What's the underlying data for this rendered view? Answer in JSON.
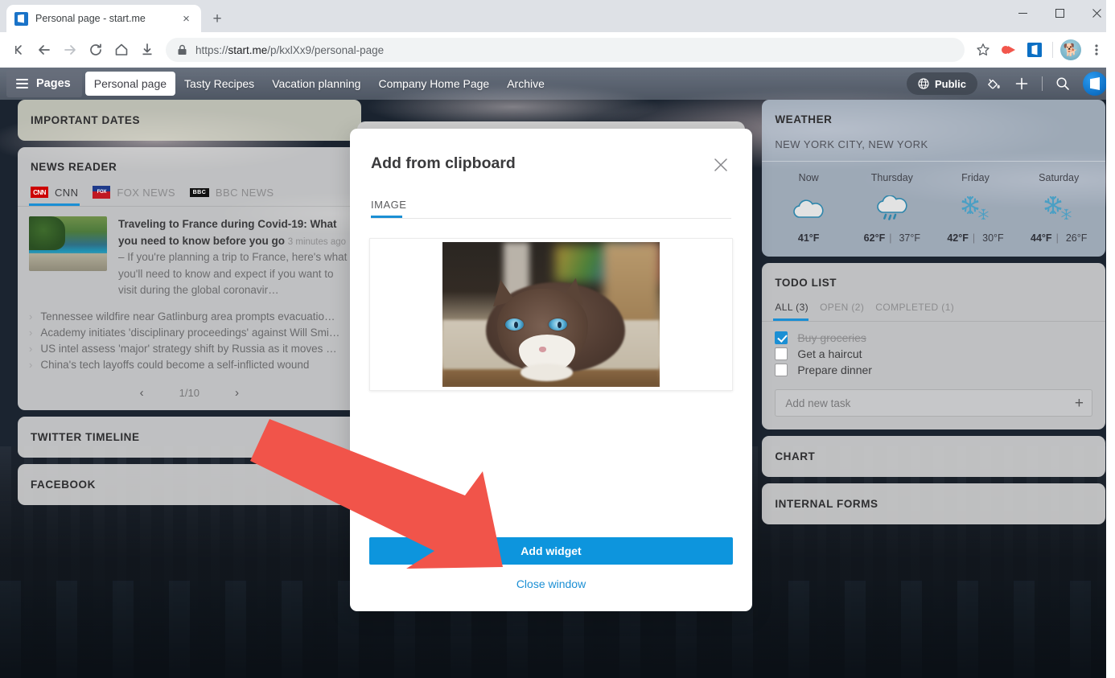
{
  "browser": {
    "tab": {
      "title": "Personal page - start.me",
      "favicon": "startme-logo-icon",
      "close": "×"
    },
    "new_tab_label": "+",
    "window_controls": {
      "minimize": "minimize-icon",
      "maximize": "maximize-icon",
      "close": "close-icon"
    },
    "toolbar": {
      "first_page": "⧏|",
      "back": "←",
      "forward": "→",
      "reload": "↻",
      "home": "⌂",
      "downloads": "download-icon",
      "lock": "lock-icon",
      "url_scheme": "https://",
      "url_host": "start.me",
      "url_path": "/p/kxlXx9/personal-page",
      "url_full": "https://start.me/p/kxlXx9/personal-page",
      "bookmark": "star-icon",
      "ext_pocket": "pocket-extension-icon",
      "ext_startme": "startme-extension-icon",
      "profile": "profile-avatar",
      "menu": "kebab-menu-icon"
    }
  },
  "topnav": {
    "pages_label": "Pages",
    "tabs": [
      {
        "label": "Personal page",
        "active": true
      },
      {
        "label": "Tasty Recipes",
        "active": false
      },
      {
        "label": "Vacation planning",
        "active": false
      },
      {
        "label": "Company Home Page",
        "active": false
      },
      {
        "label": "Archive",
        "active": false
      }
    ],
    "public_label": "Public",
    "public_icon": "globe-icon",
    "theme_icon": "paint-bucket-icon",
    "add_icon": "plus-icon",
    "search_icon": "search-icon",
    "app_logo": "startme-logo-icon"
  },
  "widgets": {
    "important_dates": {
      "title": "IMPORTANT DATES"
    },
    "news_reader": {
      "title": "NEWS READER",
      "sources": [
        {
          "label": "CNN",
          "logo": "cnn-logo",
          "active": true
        },
        {
          "label": "FOX NEWS",
          "logo": "fox-news-logo",
          "active": false
        },
        {
          "label": "BBC NEWS",
          "logo": "bbc-news-logo",
          "active": false
        }
      ],
      "featured": {
        "headline": "Traveling to France during Covid-19: What you need to know before you go",
        "time": "3 minutes ago",
        "dash": "–",
        "excerpt": "If you're planning a trip to France, here's what you'll need to know and expect if you want to visit during the global coronavir…"
      },
      "items": [
        "Tennessee wildfire near Gatlinburg area prompts evacuatio…",
        "Academy initiates 'disciplinary proceedings' against Will Smi…",
        "US intel assess 'major' strategy shift by Russia as it moves …",
        "China's tech layoffs could become a self-inflicted wound"
      ],
      "pager": {
        "prev": "‹",
        "page": "1/10",
        "next": "›"
      }
    },
    "twitter_timeline": {
      "title": "TWITTER TIMELINE"
    },
    "facebook": {
      "title": "FACEBOOK"
    },
    "weather": {
      "title": "WEATHER",
      "location": "NEW YORK CITY, NEW YORK",
      "days": [
        {
          "name": "Now",
          "icon": "cloud-icon",
          "high": "41°F",
          "low": ""
        },
        {
          "name": "Thursday",
          "icon": "rain-cloud-icon",
          "high": "62°F",
          "low": "37°F"
        },
        {
          "name": "Friday",
          "icon": "snow-icon",
          "high": "42°F",
          "low": "30°F"
        },
        {
          "name": "Saturday",
          "icon": "snow-icon",
          "high": "44°F",
          "low": "26°F"
        }
      ],
      "separator": "|"
    },
    "todo_list": {
      "title": "TODO LIST",
      "tabs": [
        {
          "label": "ALL (3)",
          "active": true
        },
        {
          "label": "OPEN (2)",
          "active": false
        },
        {
          "label": "COMPLETED (1)",
          "active": false
        }
      ],
      "items": [
        {
          "label": "Buy groceries",
          "done": true
        },
        {
          "label": "Get a haircut",
          "done": false
        },
        {
          "label": "Prepare dinner",
          "done": false
        }
      ],
      "add_placeholder": "Add new task",
      "add_value": "",
      "add_icon": "plus-icon"
    },
    "chart": {
      "title": "CHART"
    },
    "internal_forms": {
      "title": "INTERNAL FORMS"
    }
  },
  "modal": {
    "title": "Add from clipboard",
    "close_icon": "close-icon",
    "tabs": [
      {
        "label": "IMAGE",
        "active": true
      }
    ],
    "preview_image": "cat-photo",
    "primary_button": "Add widget",
    "secondary_link": "Close window"
  },
  "annotation": {
    "arrow_color": "#f1544a",
    "points_to": "Add widget"
  },
  "colors": {
    "accent": "#1b8fd4",
    "primary_button": "#0d95dd",
    "arrow": "#f1544a",
    "widget_bg": "#d6d6d6",
    "important_dates_bg": "#d6d6c8",
    "weather_bg": "#becbd8"
  }
}
